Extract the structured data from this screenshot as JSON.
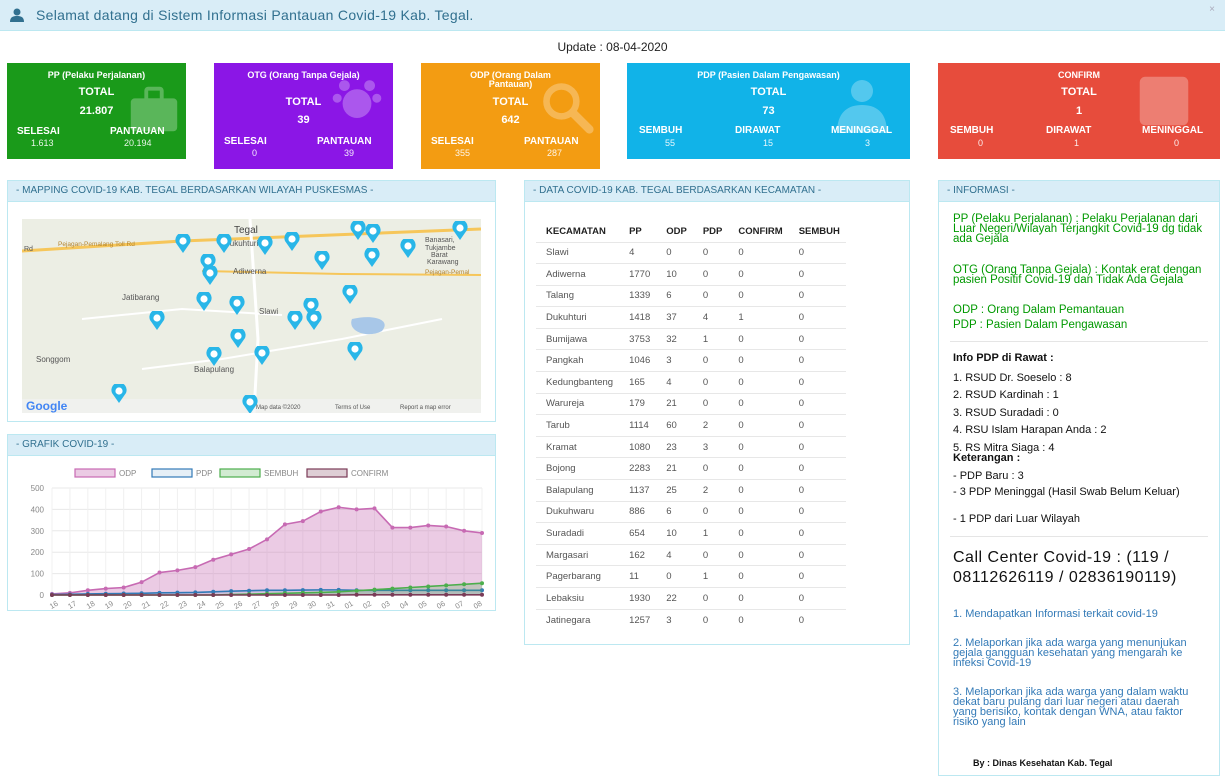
{
  "topbar": {
    "welcome": "Selamat datang di Sistem Informasi Pantauan Covid-19 Kab. Tegal.",
    "close": "×"
  },
  "update_text": "Update : 08-04-2020",
  "cards": {
    "pp": {
      "title": "PP (Pelaku Perjalanan)",
      "total_label": "TOTAL",
      "total": "21.807",
      "l1": "SELESAI",
      "v1": "1.613",
      "l2": "PANTAUAN",
      "v2": "20.194",
      "color": "#1a9a1a"
    },
    "otg": {
      "title": "OTG (Orang Tanpa Gejala)",
      "total_label": "TOTAL",
      "total": "39",
      "l1": "SELESAI",
      "v1": "0",
      "l2": "PANTAUAN",
      "v2": "39",
      "color": "#8b16e6"
    },
    "odp": {
      "title": "ODP (Orang Dalam Pantauan)",
      "total_label": "TOTAL",
      "total": "642",
      "l1": "SELESAI",
      "v1": "355",
      "l2": "PANTAUAN",
      "v2": "287",
      "color": "#f39c12"
    },
    "pdp": {
      "title": "PDP (Pasien Dalam Pengawasan)",
      "total_label": "TOTAL",
      "total": "73",
      "l1": "SEMBUH",
      "v1": "55",
      "l2": "DIRAWAT",
      "v2": "15",
      "l3": "MENINGGAL",
      "v3": "3",
      "color": "#11b3e8"
    },
    "confirm": {
      "title": "CONFIRM",
      "total_label": "TOTAL",
      "total": "1",
      "l1": "SEMBUH",
      "v1": "0",
      "l2": "DIRAWAT",
      "v2": "1",
      "l3": "MENINGGAL",
      "v3": "0",
      "color": "#e74c3c"
    }
  },
  "map_panel": {
    "title": "- MAPPING COVID-19 KAB. TEGAL BERDASARKAN WILAYAH PUSKESMAS -",
    "labels": {
      "tegal": "Tegal",
      "dukuhturi": "Dukuhturi",
      "adiwerna": "Adiwerna",
      "jatibarang": "Jatibarang",
      "slawi": "Slawi",
      "songgom": "Songgom",
      "balapulang": "Balapulang",
      "banasari": "Banasari,",
      "tukjambe": "Tukjambe",
      "barat": "Barat",
      "karawang": "Karawang",
      "pejagan": "Pejagan-Pemalang Toll Rd",
      "rd": "Rd",
      "pejagan2": "Pejagan-Pemal",
      "mapdata": "Map data ©2020",
      "terms": "Terms of Use",
      "report": "Report a map error",
      "google": "Google"
    }
  },
  "chart_panel": {
    "title": "- GRAFIK COVID-19 -"
  },
  "chart_data": {
    "type": "line",
    "x": [
      "16",
      "17",
      "18",
      "19",
      "20",
      "21",
      "22",
      "23",
      "24",
      "25",
      "26",
      "27",
      "28",
      "29",
      "30",
      "31",
      "01",
      "02",
      "03",
      "04",
      "05",
      "06",
      "07",
      "08"
    ],
    "ylim": [
      0,
      500
    ],
    "yticks": [
      0,
      100,
      200,
      300,
      400,
      500
    ],
    "series": [
      {
        "name": "ODP",
        "values": [
          5,
          10,
          22,
          30,
          35,
          60,
          105,
          115,
          130,
          165,
          190,
          215,
          260,
          330,
          345,
          390,
          410,
          400,
          405,
          315,
          315,
          325,
          320,
          300,
          290
        ],
        "color": "#c76ab3"
      },
      {
        "name": "PDP",
        "values": [
          2,
          3,
          5,
          6,
          7,
          8,
          10,
          11,
          12,
          15,
          18,
          20,
          22,
          22,
          23,
          24,
          24,
          22,
          22,
          22,
          22,
          22,
          22,
          22,
          22
        ],
        "color": "#337ab7"
      },
      {
        "name": "SEMBUH",
        "values": [
          0,
          0,
          0,
          0,
          0,
          0,
          0,
          0,
          0,
          0,
          2,
          4,
          6,
          8,
          10,
          12,
          15,
          20,
          25,
          30,
          35,
          40,
          45,
          50,
          55
        ],
        "color": "#4cae4c"
      },
      {
        "name": "CONFIRM",
        "values": [
          0,
          0,
          0,
          0,
          0,
          0,
          0,
          0,
          0,
          0,
          0,
          0,
          0,
          0,
          0,
          0,
          0,
          1,
          1,
          1,
          1,
          1,
          1,
          1,
          1
        ],
        "color": "#7a3b57"
      }
    ]
  },
  "table_panel": {
    "title": "- DATA COVID-19 KAB. TEGAL BERDASARKAN KECAMATAN -",
    "headers": [
      "KECAMATAN",
      "PP",
      "ODP",
      "PDP",
      "CONFIRM",
      "SEMBUH"
    ],
    "rows": [
      [
        "Slawi",
        "4",
        "0",
        "0",
        "0",
        "0"
      ],
      [
        "Adiwerna",
        "1770",
        "10",
        "0",
        "0",
        "0"
      ],
      [
        "Talang",
        "1339",
        "6",
        "0",
        "0",
        "0"
      ],
      [
        "Dukuhturi",
        "1418",
        "37",
        "4",
        "1",
        "0"
      ],
      [
        "Bumijawa",
        "3753",
        "32",
        "1",
        "0",
        "0"
      ],
      [
        "Pangkah",
        "1046",
        "3",
        "0",
        "0",
        "0"
      ],
      [
        "Kedungbanteng",
        "165",
        "4",
        "0",
        "0",
        "0"
      ],
      [
        "Warureja",
        "179",
        "21",
        "0",
        "0",
        "0"
      ],
      [
        "Tarub",
        "1114",
        "60",
        "2",
        "0",
        "0"
      ],
      [
        "Kramat",
        "1080",
        "23",
        "3",
        "0",
        "0"
      ],
      [
        "Bojong",
        "2283",
        "21",
        "0",
        "0",
        "0"
      ],
      [
        "Balapulang",
        "1137",
        "25",
        "2",
        "0",
        "0"
      ],
      [
        "Dukuhwaru",
        "886",
        "6",
        "0",
        "0",
        "0"
      ],
      [
        "Suradadi",
        "654",
        "10",
        "1",
        "0",
        "0"
      ],
      [
        "Margasari",
        "162",
        "4",
        "0",
        "0",
        "0"
      ],
      [
        "Pagerbarang",
        "11",
        "0",
        "1",
        "0",
        "0"
      ],
      [
        "Lebaksiu",
        "1930",
        "22",
        "0",
        "0",
        "0"
      ],
      [
        "Jatinegara",
        "1257",
        "3",
        "0",
        "0",
        "0"
      ]
    ]
  },
  "info_panel": {
    "title": "- INFORMASI -",
    "def_pp": "PP (Pelaku Perjalanan) : Pelaku Perjalanan dari Luar Negeri/Wilayah Terjangkit Covid-19 dg tidak ada Gejala",
    "def_otg": "OTG (Orang Tanpa Gejala) : Kontak erat dengan pasien Positif Covid-19 dan Tidak Ada Gejala",
    "def_odp": "ODP : Orang Dalam Pemantauan",
    "def_pdp": "PDP : Pasien Dalam Pengawasan",
    "rawat_title": "Info PDP di Rawat :",
    "rawat": [
      "1. RSUD Dr. Soeselo : 8",
      "2. RSUD Kardinah : 1",
      "3. RSUD Suradadi : 0",
      "4. RSU Islam Harapan Anda : 2",
      "5. RS Mitra Siaga : 4"
    ],
    "ket_title": "Keterangan :",
    "ket": [
      "- PDP Baru : 3",
      "- 3 PDP Meninggal (Hasil Swab Belum Keluar)",
      "- 1 PDP dari Luar Wilayah"
    ],
    "call_center": "Call Center Covid-19 : (119 / 08112626119 / 02836190119)",
    "cc_items": [
      "1. Mendapatkan Informasi terkait covid-19",
      "2. Melaporkan jika ada warga yang menunjukan gejala gangguan kesehatan yang mengarah ke infeksi Covid-19",
      "3. Melaporkan jika ada warga yang dalam waktu dekat baru pulang dari luar negeri atau daerah yang berisiko, kontak dengan WNA, atau faktor risiko yang lain"
    ],
    "by": "By : Dinas Kesehatan Kab. Tegal"
  }
}
